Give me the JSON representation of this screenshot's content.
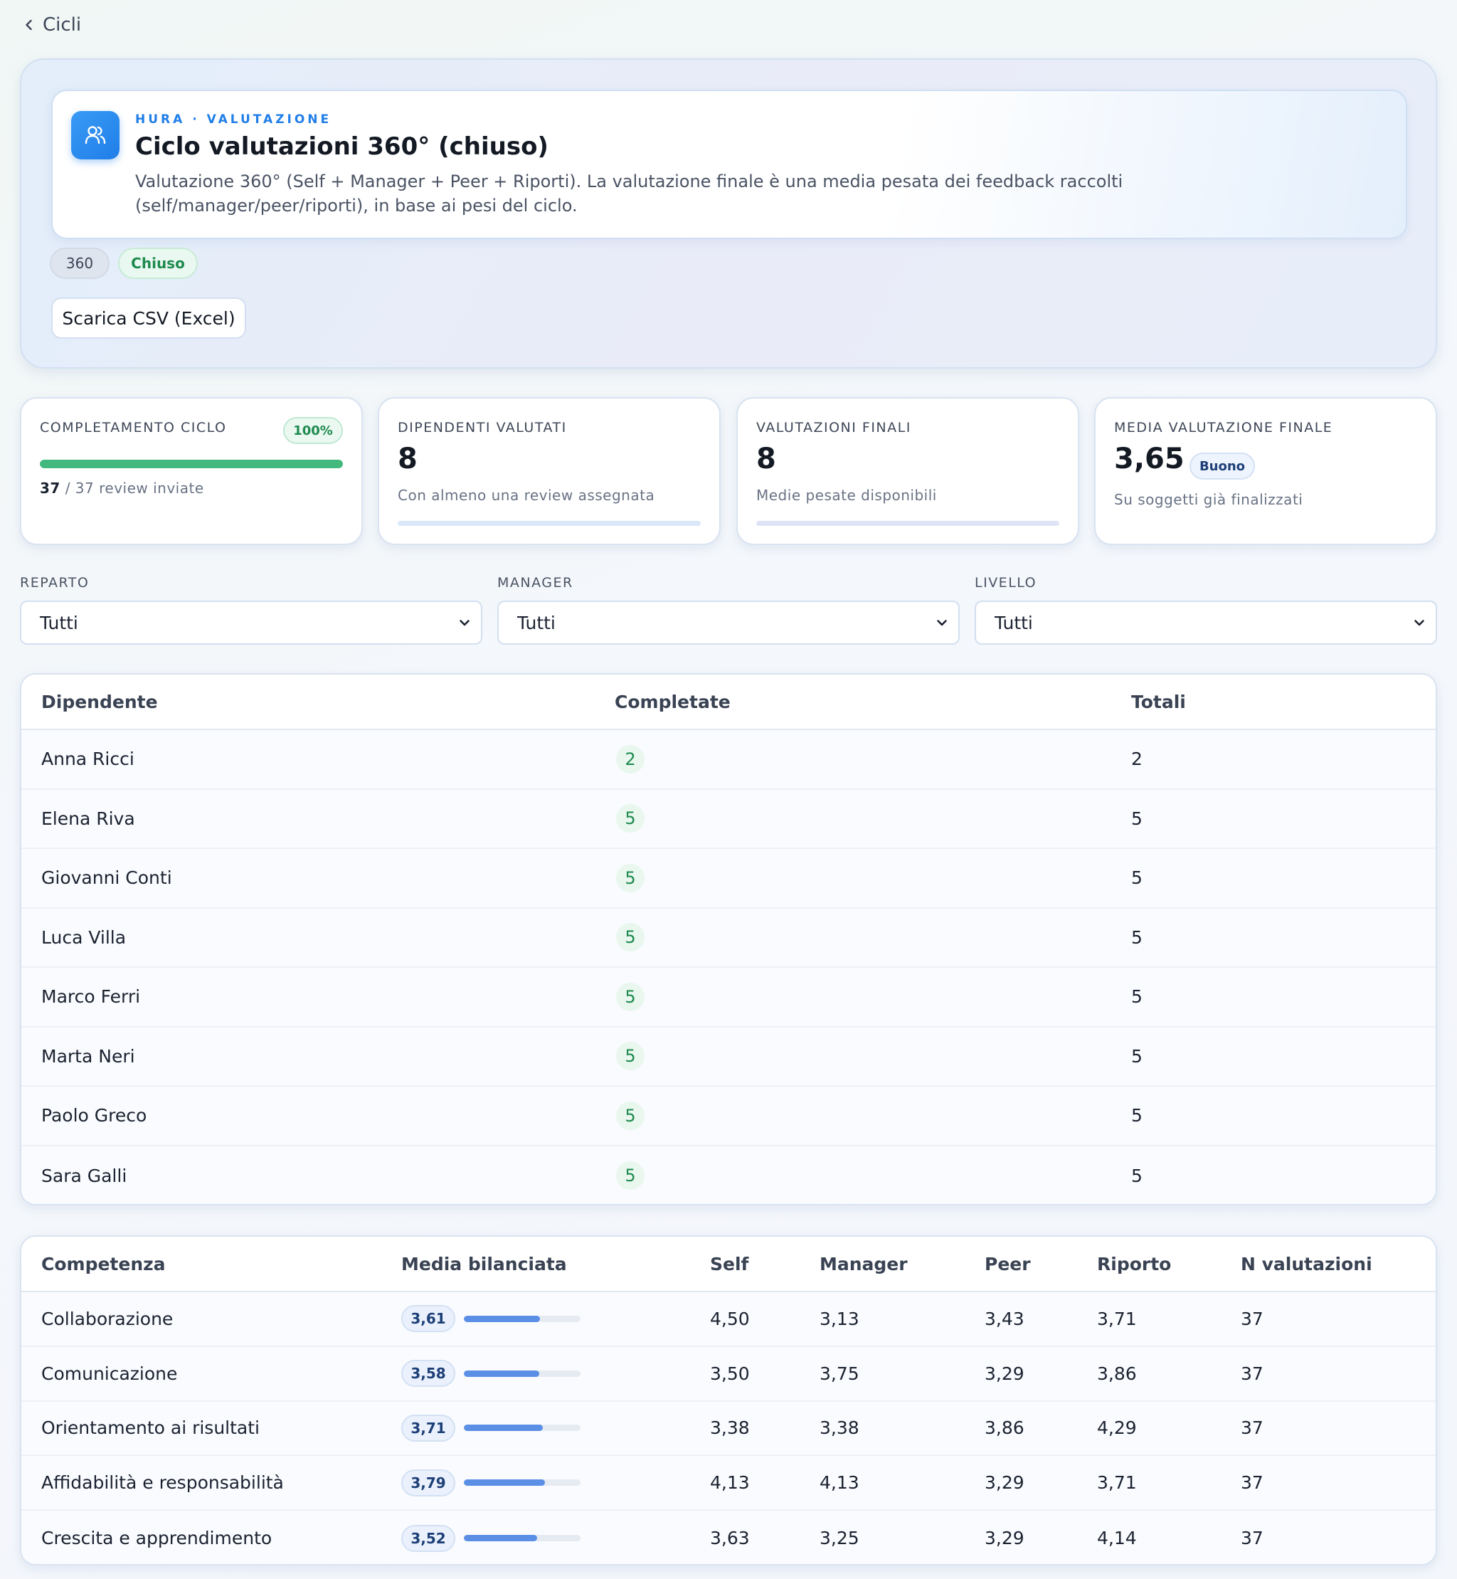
{
  "nav": {
    "back_label": "Cicli"
  },
  "hero": {
    "eyebrow": "HURA · VALUTAZIONE",
    "title": "Ciclo valutazioni 360° (chiuso)",
    "description": "Valutazione 360° (Self + Manager + Peer + Riporti). La valutazione finale è una media pesata dei feedback raccolti (self/manager/peer/riporti), in base ai pesi del ciclo.",
    "icon": "users-icon",
    "type_chip": "360",
    "status_chip": "Chiuso",
    "csv_button": "Scarica CSV (Excel)"
  },
  "stats": {
    "completion": {
      "label": "COMPLETAMENTO CICLO",
      "percent_label": "100%",
      "progress": 1.0,
      "done": "37",
      "rest": " / 37 review inviate"
    },
    "employees": {
      "label": "DIPENDENTI VALUTATI",
      "value": "8",
      "sub": "Con almeno una review assegnata"
    },
    "finals": {
      "label": "VALUTAZIONI FINALI",
      "value": "8",
      "sub": "Medie pesate disponibili"
    },
    "average": {
      "label": "MEDIA VALUTAZIONE FINALE",
      "value": "3,65",
      "grade": "Buono",
      "sub": "Su soggetti già finalizzati"
    }
  },
  "filters": [
    {
      "label": "REPARTO",
      "value": "Tutti"
    },
    {
      "label": "MANAGER",
      "value": "Tutti"
    },
    {
      "label": "LIVELLO",
      "value": "Tutti"
    }
  ],
  "employees_table": {
    "headers": [
      "Dipendente",
      "Completate",
      "Totali"
    ],
    "rows": [
      {
        "name": "Anna Ricci",
        "done": "2",
        "total": "2"
      },
      {
        "name": "Elena Riva",
        "done": "5",
        "total": "5"
      },
      {
        "name": "Giovanni Conti",
        "done": "5",
        "total": "5"
      },
      {
        "name": "Luca Villa",
        "done": "5",
        "total": "5"
      },
      {
        "name": "Marco Ferri",
        "done": "5",
        "total": "5"
      },
      {
        "name": "Marta Neri",
        "done": "5",
        "total": "5"
      },
      {
        "name": "Paolo Greco",
        "done": "5",
        "total": "5"
      },
      {
        "name": "Sara Galli",
        "done": "5",
        "total": "5"
      }
    ]
  },
  "competencies_table": {
    "headers": [
      "Competenza",
      "Media bilanciata",
      "Self",
      "Manager",
      "Peer",
      "Riporto",
      "N valutazioni"
    ],
    "scale_max": 5,
    "rows": [
      {
        "name": "Collaborazione",
        "avg": "3,61",
        "avg_num": 3.61,
        "self": "4,50",
        "manager": "3,13",
        "peer": "3,43",
        "riporto": "3,71",
        "n": "37"
      },
      {
        "name": "Comunicazione",
        "avg": "3,58",
        "avg_num": 3.58,
        "self": "3,50",
        "manager": "3,75",
        "peer": "3,29",
        "riporto": "3,86",
        "n": "37"
      },
      {
        "name": "Orientamento ai risultati",
        "avg": "3,71",
        "avg_num": 3.71,
        "self": "3,38",
        "manager": "3,38",
        "peer": "3,86",
        "riporto": "4,29",
        "n": "37"
      },
      {
        "name": "Affidabilità e responsabilità",
        "avg": "3,79",
        "avg_num": 3.79,
        "self": "4,13",
        "manager": "4,13",
        "peer": "3,29",
        "riporto": "3,71",
        "n": "37"
      },
      {
        "name": "Crescita e apprendimento",
        "avg": "3,52",
        "avg_num": 3.52,
        "self": "3,63",
        "manager": "3,25",
        "peer": "3,29",
        "riporto": "4,14",
        "n": "37"
      }
    ]
  },
  "colors": {
    "accent": "#1f7ee8",
    "success": "#1e8a4e",
    "progress": "#43b97d",
    "bar": "#5b8fe6"
  }
}
